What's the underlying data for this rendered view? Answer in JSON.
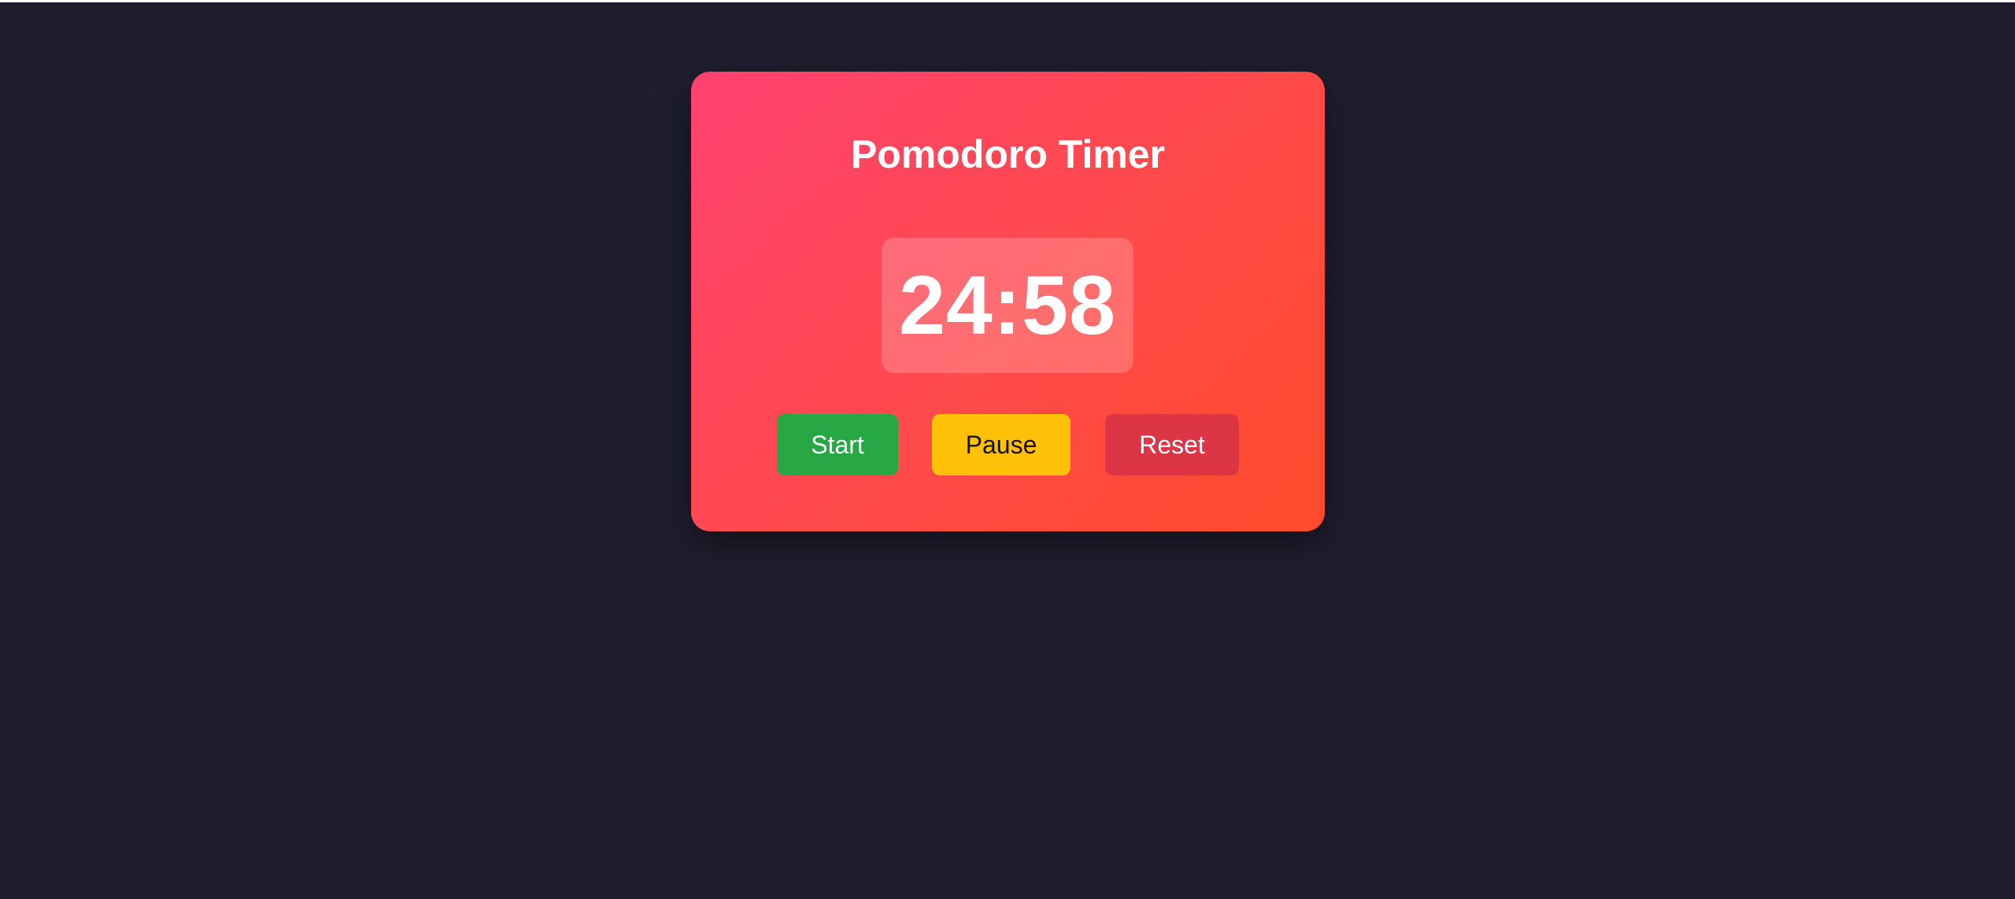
{
  "page": {
    "background_color": "#1f1e2e"
  },
  "card": {
    "title": "Pomodoro Timer",
    "timer_display": "24:58",
    "gradient_colors": [
      "#ff4170",
      "#ff4b2b"
    ]
  },
  "controls": {
    "start_label": "Start",
    "pause_label": "Pause",
    "reset_label": "Reset",
    "start_color": "#28a745",
    "pause_color": "#ffc107",
    "reset_color": "#dc3545"
  }
}
